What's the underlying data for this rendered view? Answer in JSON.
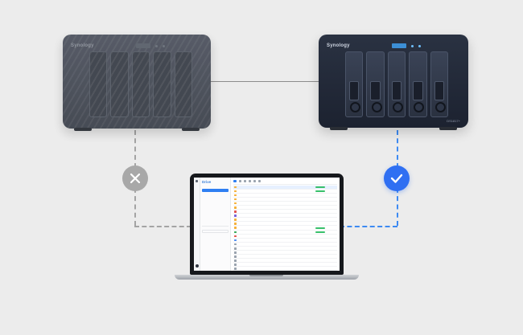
{
  "nas_left": {
    "brand": "Synology",
    "state": "inactive"
  },
  "nas_right": {
    "brand": "Synology",
    "model": "DS1817+",
    "state": "active"
  },
  "status": {
    "left": "x-icon",
    "right": "check-icon"
  },
  "colors": {
    "accent": "#2f6ff2",
    "inactive": "#a8a8a8",
    "background": "#ececec",
    "tag": "#38c06b"
  },
  "laptop": {
    "brand": "",
    "app": {
      "name": "Drive",
      "name_sub": "",
      "main_title": "",
      "sidebar": {
        "items": [
          {
            "label": "",
            "active": true
          },
          {
            "label": ""
          },
          {
            "label": ""
          },
          {
            "label": ""
          },
          {
            "label": ""
          },
          {
            "label": ""
          },
          {
            "label": ""
          },
          {
            "label": ""
          }
        ],
        "lower_items": [
          {
            "label": ""
          },
          {
            "label": ""
          },
          {
            "label": ""
          },
          {
            "label": ""
          },
          {
            "label": ""
          },
          {
            "label": ""
          }
        ]
      },
      "rows": [
        {
          "icon_color": "#f5b13a",
          "tag": true,
          "selected": true
        },
        {
          "icon_color": "#f5b13a",
          "tag": true
        },
        {
          "icon_color": "#f5b13a",
          "tag": false
        },
        {
          "icon_color": "#f5b13a",
          "tag": false
        },
        {
          "icon_color": "#f5b13a",
          "tag": false
        },
        {
          "icon_color": "#f5b13a",
          "tag": false
        },
        {
          "icon_color": "#e2554f",
          "tag": false
        },
        {
          "icon_color": "#7b61d9",
          "tag": false
        },
        {
          "icon_color": "#f5b13a",
          "tag": false
        },
        {
          "icon_color": "#f5b13a",
          "tag": false
        },
        {
          "icon_color": "#f5b13a",
          "tag": true
        },
        {
          "icon_color": "#39a85a",
          "tag": true
        },
        {
          "icon_color": "#e2554f",
          "tag": false
        },
        {
          "icon_color": "#4f8ef2",
          "tag": false
        },
        {
          "icon_color": "#9aa3ae",
          "tag": false
        },
        {
          "icon_color": "#9aa3ae",
          "tag": false
        },
        {
          "icon_color": "#9aa3ae",
          "tag": false
        },
        {
          "icon_color": "#9aa3ae",
          "tag": false
        },
        {
          "icon_color": "#9aa3ae",
          "tag": false
        },
        {
          "icon_color": "#9aa3ae",
          "tag": false
        },
        {
          "icon_color": "#9aa3ae",
          "tag": false
        },
        {
          "icon_color": "#9aa3ae",
          "tag": false
        },
        {
          "icon_color": "#9aa3ae",
          "tag": false
        },
        {
          "icon_color": "#9aa3ae",
          "tag": false
        }
      ]
    }
  }
}
